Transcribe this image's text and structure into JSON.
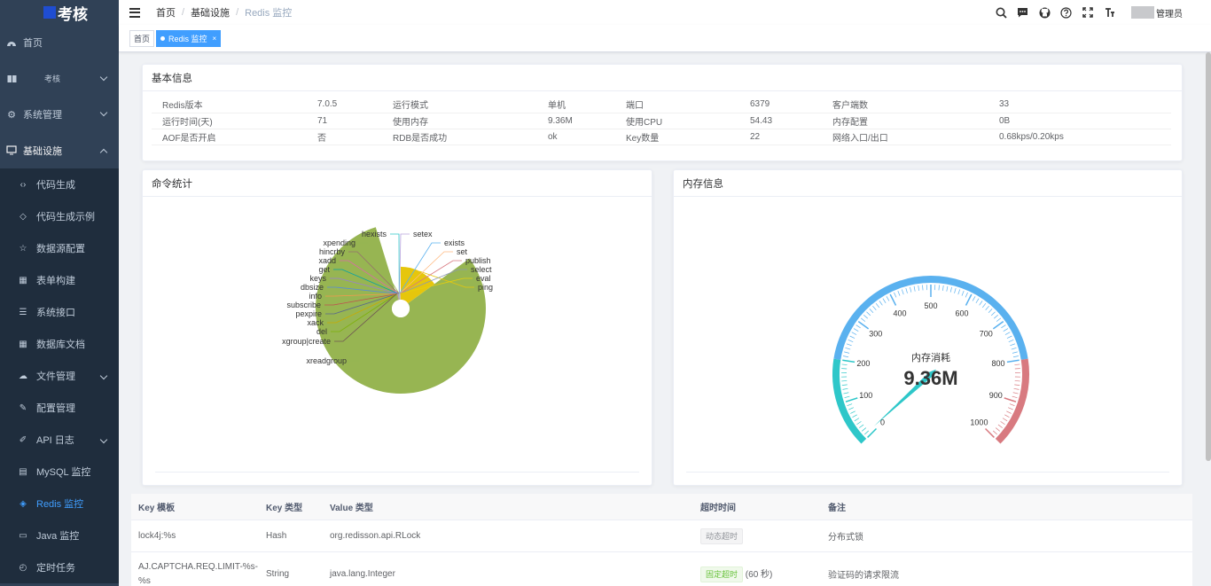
{
  "app": {
    "logo_text": "考核"
  },
  "sidebar": {
    "items": [
      {
        "label": "首页",
        "icon": "dashboard-icon"
      },
      {
        "label": "考核",
        "icon": "book-icon"
      },
      {
        "label": "系统管理",
        "icon": "gear-icon"
      },
      {
        "label": "基础设施",
        "icon": "monitor-icon"
      }
    ],
    "sub_items": [
      {
        "label": "代码生成",
        "icon": "code-icon"
      },
      {
        "label": "代码生成示例",
        "icon": "shield-icon"
      },
      {
        "label": "数据源配置",
        "icon": "star-icon"
      },
      {
        "label": "表单构建",
        "icon": "form-icon"
      },
      {
        "label": "系统接口",
        "icon": "sliders-icon"
      },
      {
        "label": "数据库文档",
        "icon": "table-icon"
      },
      {
        "label": "文件管理",
        "icon": "upload-icon"
      },
      {
        "label": "配置管理",
        "icon": "edit-icon"
      },
      {
        "label": "API 日志",
        "icon": "log-icon"
      },
      {
        "label": "MySQL 监控",
        "icon": "server-icon"
      },
      {
        "label": "Redis 监控",
        "icon": "stack-icon"
      },
      {
        "label": "Java 监控",
        "icon": "monitor-icon"
      },
      {
        "label": "定时任务",
        "icon": "clock-icon"
      }
    ]
  },
  "navbar": {
    "breadcrumb": [
      "首页",
      "基础设施",
      "Redis 监控"
    ],
    "user_name": "管理员"
  },
  "tags": {
    "home": "首页",
    "active": "Redis 监控",
    "close": "×"
  },
  "basic": {
    "title": "基本信息",
    "rows": [
      [
        "Redis版本",
        "7.0.5",
        "运行模式",
        "单机",
        "端口",
        "6379",
        "客户端数",
        "33"
      ],
      [
        "运行时间(天)",
        "71",
        "使用内存",
        "9.36M",
        "使用CPU",
        "54.43",
        "内存配置",
        "0B"
      ],
      [
        "AOF是否开启",
        "否",
        "RDB是否成功",
        "ok",
        "Key数量",
        "22",
        "网络入口/出口",
        "0.68kps/0.20kps"
      ]
    ]
  },
  "commands": {
    "title": "命令统计",
    "chart_data": {
      "type": "pie",
      "series": [
        {
          "name": "xreadgroup",
          "value": 75
        },
        {
          "name": "ping",
          "value": 14
        },
        {
          "name": "hexists",
          "value": 0.5
        },
        {
          "name": "setex",
          "value": 0.5
        },
        {
          "name": "exists",
          "value": 0.5
        },
        {
          "name": "set",
          "value": 0.5
        },
        {
          "name": "publish",
          "value": 0.5
        },
        {
          "name": "select",
          "value": 0.5
        },
        {
          "name": "eval",
          "value": 0.5
        },
        {
          "name": "xpending",
          "value": 0.5
        },
        {
          "name": "hincrby",
          "value": 0.5
        },
        {
          "name": "xadd",
          "value": 0.5
        },
        {
          "name": "get",
          "value": 0.5
        },
        {
          "name": "keys",
          "value": 0.5
        },
        {
          "name": "dbsize",
          "value": 0.5
        },
        {
          "name": "info",
          "value": 0.5
        },
        {
          "name": "subscribe",
          "value": 0.5
        },
        {
          "name": "pexpire",
          "value": 0.5
        },
        {
          "name": "xack",
          "value": 0.5
        },
        {
          "name": "del",
          "value": 0.5
        },
        {
          "name": "xgroup|create",
          "value": 0.5
        }
      ]
    }
  },
  "memory": {
    "title": "内存信息",
    "gauge": {
      "min": 0,
      "max": 1000,
      "value": 9.36,
      "name": "内存消耗",
      "value_text": "9.36M",
      "ticks": [
        "0",
        "100",
        "200",
        "300",
        "400",
        "500",
        "600",
        "700",
        "800",
        "900",
        "1000"
      ],
      "colors": {
        "low": "#2ec7c9",
        "mid": "#5ab1ef",
        "high": "#d87a80",
        "pointer": "#2ec7c9"
      }
    }
  },
  "keys_table": {
    "headers": [
      "Key 模板",
      "Key 类型",
      "Value 类型",
      "超时时间",
      "备注"
    ],
    "rows": [
      {
        "key": "lock4j:%s",
        "type": "Hash",
        "value_type": "org.redisson.api.RLock",
        "timeout_tag": "动态超时",
        "timeout_extra": "",
        "remark": "分布式锁"
      },
      {
        "key": "AJ.CAPTCHA.REQ.LIMIT-%s-%s",
        "type": "String",
        "value_type": "java.lang.Integer",
        "timeout_tag": "固定超时",
        "timeout_extra": "(60 秒)",
        "remark": "验证码的请求限流"
      }
    ]
  }
}
